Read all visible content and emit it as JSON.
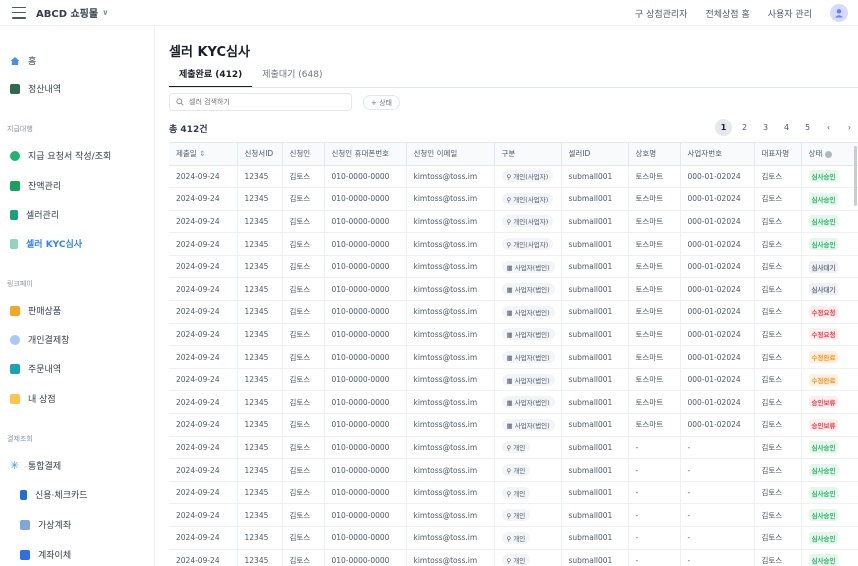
{
  "app": {
    "brand": "ABCD 쇼핑몰"
  },
  "topnav": {
    "items": [
      "구 상점관리자",
      "전체상점 홈",
      "사용자 관리"
    ]
  },
  "sidebar": {
    "home": "홈",
    "settlement": "정산내역",
    "sec1": "지급대행",
    "payout_request": "지급 요청서 작성/조회",
    "balance": "잔액관리",
    "seller_mgmt": "셀러관리",
    "seller_kyc": "셀러 KYC심사",
    "sec2": "링크페이",
    "products": "판매상품",
    "personal_pay": "개인결제창",
    "orders": "주문내역",
    "my_store": "내 상점",
    "sec3": "결제조회",
    "integrated": "통합결제",
    "card": "신용·체크카드",
    "virtual": "가상계좌",
    "transfer": "계좌이체"
  },
  "main": {
    "title": "셀러 KYC심사",
    "tab_done": "제출완료 (412)",
    "tab_wait": "제출대기 (648)",
    "search_placeholder": "셀러 검색하기",
    "filter_label": "+ 상태",
    "total": "총 412건",
    "pages": [
      "1",
      "2",
      "3",
      "4",
      "5"
    ]
  },
  "table": {
    "headers": [
      "제출일",
      "신청서ID",
      "신청인",
      "신청인 휴대폰번호",
      "신청인 이메일",
      "구분",
      "셀러ID",
      "상호명",
      "사업자번호",
      "대표자명",
      "상태"
    ],
    "rows": [
      [
        "2024-09-24",
        "12345",
        "김토스",
        "010-0000-0000",
        "kimtoss@toss.im",
        "개인(사업자)",
        "submall001",
        "토스마트",
        "000-01-02024",
        "김토스",
        "심사승인"
      ],
      [
        "2024-09-24",
        "12345",
        "김토스",
        "010-0000-0000",
        "kimtoss@toss.im",
        "개인(사업자)",
        "submall001",
        "토스마트",
        "000-01-02024",
        "김토스",
        "심사승인"
      ],
      [
        "2024-09-24",
        "12345",
        "김토스",
        "010-0000-0000",
        "kimtoss@toss.im",
        "개인(사업자)",
        "submall001",
        "토스마트",
        "000-01-02024",
        "김토스",
        "심사승인"
      ],
      [
        "2024-09-24",
        "12345",
        "김토스",
        "010-0000-0000",
        "kimtoss@toss.im",
        "개인(사업자)",
        "submall001",
        "토스마트",
        "000-01-02024",
        "김토스",
        "심사승인"
      ],
      [
        "2024-09-24",
        "12345",
        "김토스",
        "010-0000-0000",
        "kimtoss@toss.im",
        "사업자(법인)",
        "submall001",
        "토스마트",
        "000-01-02024",
        "김토스",
        "심사대기"
      ],
      [
        "2024-09-24",
        "12345",
        "김토스",
        "010-0000-0000",
        "kimtoss@toss.im",
        "사업자(법인)",
        "submall001",
        "토스마트",
        "000-01-02024",
        "김토스",
        "심사대기"
      ],
      [
        "2024-09-24",
        "12345",
        "김토스",
        "010-0000-0000",
        "kimtoss@toss.im",
        "사업자(법인)",
        "submall001",
        "토스마트",
        "000-01-02024",
        "김토스",
        "수정요청"
      ],
      [
        "2024-09-24",
        "12345",
        "김토스",
        "010-0000-0000",
        "kimtoss@toss.im",
        "사업자(법인)",
        "submall001",
        "토스마트",
        "000-01-02024",
        "김토스",
        "수정요청"
      ],
      [
        "2024-09-24",
        "12345",
        "김토스",
        "010-0000-0000",
        "kimtoss@toss.im",
        "사업자(법인)",
        "submall001",
        "토스마트",
        "000-01-02024",
        "김토스",
        "수정완료"
      ],
      [
        "2024-09-24",
        "12345",
        "김토스",
        "010-0000-0000",
        "kimtoss@toss.im",
        "사업자(법인)",
        "submall001",
        "토스마트",
        "000-01-02024",
        "김토스",
        "수정완료"
      ],
      [
        "2024-09-24",
        "12345",
        "김토스",
        "010-0000-0000",
        "kimtoss@toss.im",
        "사업자(법인)",
        "submall001",
        "토스마트",
        "000-01-02024",
        "김토스",
        "승인보류"
      ],
      [
        "2024-09-24",
        "12345",
        "김토스",
        "010-0000-0000",
        "kimtoss@toss.im",
        "사업자(법인)",
        "submall001",
        "토스마트",
        "000-01-02024",
        "김토스",
        "승인보류"
      ],
      [
        "2024-09-24",
        "12345",
        "김토스",
        "010-0000-0000",
        "kimtoss@toss.im",
        "개인",
        "submall001",
        "-",
        "-",
        "김토스",
        "심사승인"
      ],
      [
        "2024-09-24",
        "12345",
        "김토스",
        "010-0000-0000",
        "kimtoss@toss.im",
        "개인",
        "submall001",
        "-",
        "-",
        "김토스",
        "심사승인"
      ],
      [
        "2024-09-24",
        "12345",
        "김토스",
        "010-0000-0000",
        "kimtoss@toss.im",
        "개인",
        "submall001",
        "-",
        "-",
        "김토스",
        "심사승인"
      ],
      [
        "2024-09-24",
        "12345",
        "김토스",
        "010-0000-0000",
        "kimtoss@toss.im",
        "개인",
        "submall001",
        "-",
        "-",
        "김토스",
        "심사승인"
      ],
      [
        "2024-09-24",
        "12345",
        "김토스",
        "010-0000-0000",
        "kimtoss@toss.im",
        "개인",
        "submall001",
        "-",
        "-",
        "김토스",
        "심사승인"
      ],
      [
        "2024-09-24",
        "12345",
        "김토스",
        "010-0000-0000",
        "kimtoss@toss.im",
        "개인",
        "submall001",
        "-",
        "-",
        "김토스",
        "심사승인"
      ]
    ]
  },
  "colors": {
    "accent": "#3182f6",
    "status": {
      "심사승인": {
        "bg": "#e5f6ec",
        "fg": "#2fb36a"
      },
      "심사대기": {
        "bg": "#eef0f3",
        "fg": "#6b7684"
      },
      "수정요청": {
        "bg": "#ffeeee",
        "fg": "#f04452"
      },
      "수정완료": {
        "bg": "#fff1e0",
        "fg": "#fd9528"
      },
      "승인보류": {
        "bg": "#ffeeee",
        "fg": "#f04452"
      }
    }
  }
}
